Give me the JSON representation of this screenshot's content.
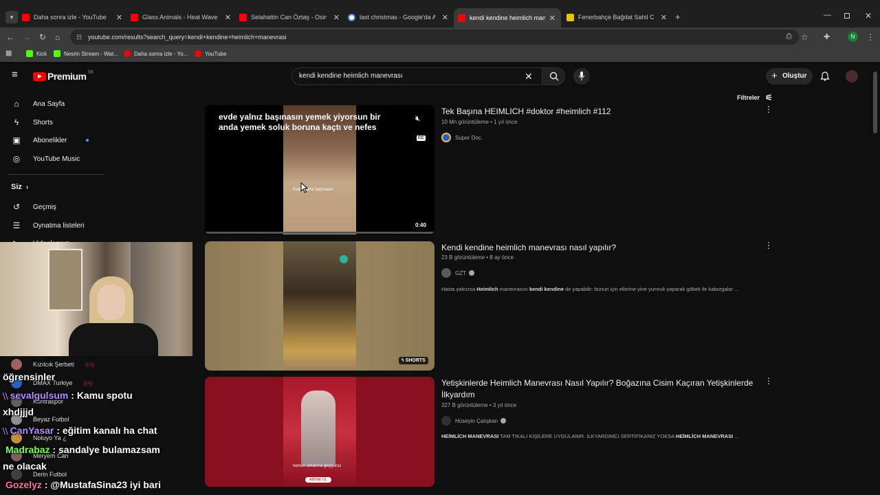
{
  "tabs": [
    {
      "title": "Daha sonra izle - YouTube",
      "color": "#ff0000"
    },
    {
      "title": "Glass Animals - Heat Waves - Yo",
      "color": "#ff0000"
    },
    {
      "title": "Selahattin Can Öztaş - Osimhen",
      "color": "#ff0000"
    },
    {
      "title": "last christmas - Google'da Ara",
      "color": "#4285f4"
    },
    {
      "title": "kendi kendine heimlich manevra",
      "color": "#ff0000"
    },
    {
      "title": "Fenerbahçe Bağdat Sahil Cadde",
      "color": "#e5c500"
    }
  ],
  "url": "youtube.com/results?search_query=kendi+kendine+heimlich+manevrasi",
  "bookmarks": [
    {
      "label": "Kick",
      "color": "#53fc18"
    },
    {
      "label": "Nesrin Stream - Wat...",
      "color": "#53fc18"
    },
    {
      "label": "Daha sonra izle - Yo...",
      "color": "#ff0000"
    },
    {
      "label": "YouTube",
      "color": "#ff0000"
    }
  ],
  "profile_initial": "N",
  "yt": {
    "logo": "Premium",
    "logo_sup": "TR",
    "search_value": "kendi kendine heimlich manevrası",
    "create_label": "Oluştur",
    "filters_label": "Filtreler"
  },
  "sidebar": {
    "items": [
      {
        "label": "Ana Sayfa",
        "icon": "home-icon"
      },
      {
        "label": "Shorts",
        "icon": "shorts-icon"
      },
      {
        "label": "Abonelikler",
        "icon": "subscriptions-icon"
      },
      {
        "label": "YouTube Music",
        "icon": "music-icon"
      }
    ],
    "you_label": "Siz",
    "you_items": [
      {
        "label": "Geçmiş",
        "icon": "history-icon"
      },
      {
        "label": "Oynatma listeleri",
        "icon": "playlist-icon"
      },
      {
        "label": "Videolarınız",
        "icon": "video-icon"
      }
    ],
    "subscriptions": [
      {
        "label": "Kızılcık Şerbeti",
        "color": "#a06060"
      },
      {
        "label": "DMAX Turkiye",
        "color": "#3060c0"
      },
      {
        "label": "Kontraspor",
        "color": "#606060"
      },
      {
        "label": "Beyaz Futbol",
        "color": "#909090"
      },
      {
        "label": "Noluyo Ya ¿",
        "color": "#c09040"
      },
      {
        "label": "Meryem Can",
        "color": "#806060"
      },
      {
        "label": "Derin Futbol",
        "color": "#404040"
      }
    ]
  },
  "results": [
    {
      "title": "Tek Başına HEIMLICH #doktor #heimlich #112",
      "meta": "10 Mn görüntüleme • 1 yıl önce",
      "channel": "Super Doc.",
      "description": "",
      "thumb_caption": "evde yalnız başınasın yemek yiyorsun bir anda yemek soluk boruna kaçtı ve nefes",
      "overlay_text": "Evde yalnız başınasın",
      "duration": "0:40",
      "cc": "CC"
    },
    {
      "title": "Kendi kendine heimlich manevrası nasıl yapılır?",
      "meta": "23 B görüntüleme • 8 ay önce",
      "channel": "GZT",
      "description_parts": [
        "Hasta yalnızsa ",
        "Heimlich",
        " manevrasını ",
        "kendi kendine",
        " de yapabilir: bunun için ellerine yine yumruk yaparak göbek ile kaburgalar ..."
      ],
      "badge": "SHORTS"
    },
    {
      "title": "Yetişkinlerde Heimlich Manevrası Nasıl Yapılır? Boğazına Cisim Kaçıran Yetişkinlerde İlkyardım",
      "meta": "327 B görüntüleme • 3 yıl önce",
      "channel": "Hüseyin Çalışkan",
      "description_parts": [
        "HEİMLİCH MANEVRASI",
        " TAM TIKALI KİŞİLERE UYGULANIR. İLKYARDIMCI SERTİFİKANIZ YOKSA ",
        "HEİMLİCH MANEVRASI",
        " ..."
      ],
      "thumb_caption": "hemen arkasına geçiyoruz",
      "subscribe_text": "ABONE OL"
    }
  ],
  "chat": [
    {
      "user": "",
      "msg": "öğrensinler",
      "color": "#ffffff"
    },
    {
      "user": "sevalgulsum",
      "msg": " : Kamu spotu",
      "color": "#b48cff"
    },
    {
      "user": "",
      "msg": "xhdjjjd",
      "color": "#ffffff"
    },
    {
      "user": "CanYasar",
      "msg": " : eğitim kanalı ha chat",
      "color": "#b48cff"
    },
    {
      "user": "Madrabaz",
      "msg": " : sandalye bulamazsam",
      "color": "#7cff5a"
    },
    {
      "user": "",
      "msg": "ne olacak",
      "color": "#ffffff"
    },
    {
      "user": "Gozelyz",
      "msg": " : @MustafaSina23 iyi bari",
      "color": "#ff6fa0"
    }
  ]
}
